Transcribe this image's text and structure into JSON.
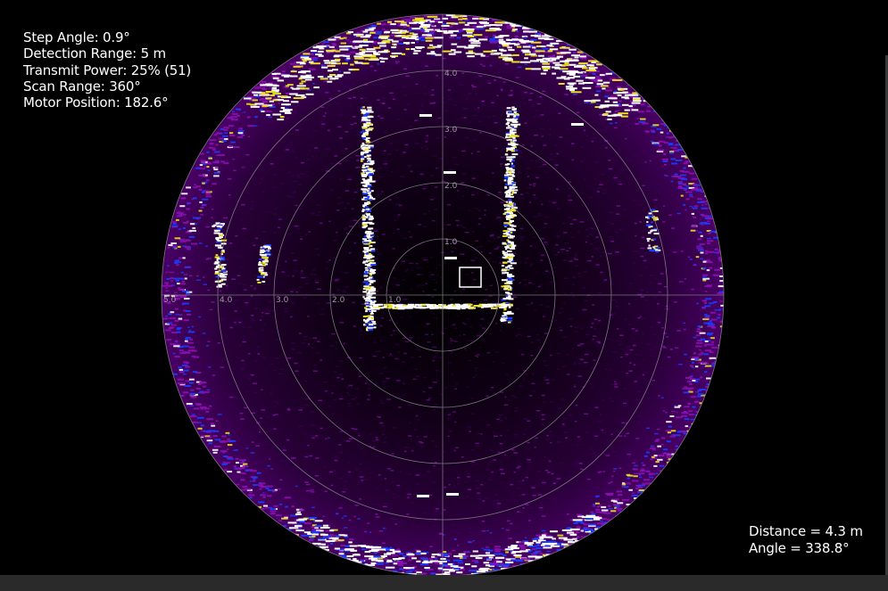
{
  "status": {
    "step_angle": "Step Angle: 0.9°",
    "detection_range": "Detection Range: 5 m",
    "transmit_power": "Transmit Power: 25% (51)",
    "scan_range": "Scan Range: 360°",
    "motor_position": "Motor Position: 182.6°"
  },
  "cursor_readout": {
    "distance": "Distance = 4.3 m",
    "angle": "Angle = 338.8°"
  },
  "sonar": {
    "range_labels_horizontal": [
      "5.0",
      "4.0",
      "3.0",
      "2.0",
      "1.0"
    ],
    "range_labels_vertical": [
      "4.0",
      "3.0",
      "2.0",
      "1.0"
    ],
    "colors": {
      "grid": "#8a8a8a",
      "echo_low": "#3a0050",
      "echo_mid": "#8a10b0",
      "echo_blue": "#1a3cff",
      "echo_high": "#ffffff",
      "echo_yellow": "#e8e020"
    }
  }
}
